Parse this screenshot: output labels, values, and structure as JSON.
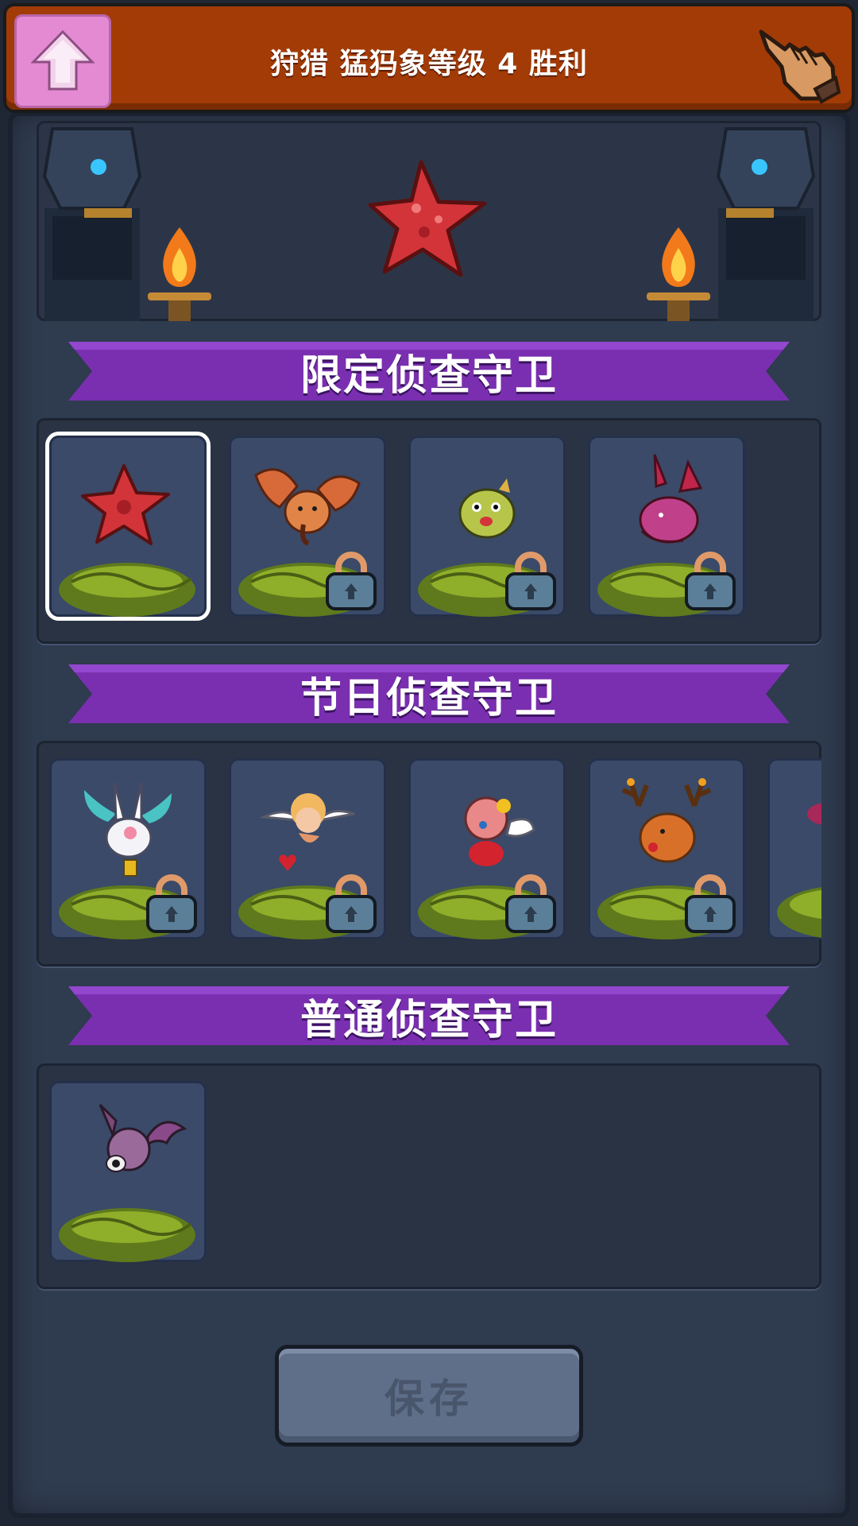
{
  "header": {
    "title": "狩猎 猛犸象等级 4 胜利",
    "back_icon": "up-arrow-icon",
    "hand_icon": "pointing-hand-icon"
  },
  "sections": [
    {
      "title": "限定侦查守卫",
      "cards": [
        {
          "creature": "red-starfish-icon",
          "locked": false,
          "selected": true
        },
        {
          "creature": "flying-elephant-icon",
          "locked": true,
          "selected": false
        },
        {
          "creature": "pufferfish-icon",
          "locked": true,
          "selected": false
        },
        {
          "creature": "pink-dragon-icon",
          "locked": true,
          "selected": false
        }
      ]
    },
    {
      "title": "节日侦查守卫",
      "cards": [
        {
          "creature": "white-rabbit-icon",
          "locked": true,
          "selected": false
        },
        {
          "creature": "cupid-icon",
          "locked": true,
          "selected": false
        },
        {
          "creature": "pink-fairy-icon",
          "locked": true,
          "selected": false
        },
        {
          "creature": "reindeer-icon",
          "locked": true,
          "selected": false
        },
        {
          "creature": "partial-creature-icon",
          "locked": false,
          "selected": false
        }
      ]
    },
    {
      "title": "普通侦查守卫",
      "cards": [
        {
          "creature": "bat-eyeball-icon",
          "locked": false,
          "selected": false
        }
      ]
    }
  ],
  "footer": {
    "save_label": "保存"
  },
  "colors": {
    "header_bg": "#a33b07",
    "ribbon": "#7a2fb0",
    "card_bg": "#3a4a68",
    "save_bg": "#5f6f8a"
  }
}
